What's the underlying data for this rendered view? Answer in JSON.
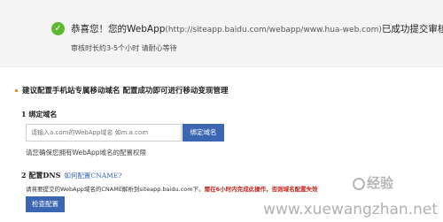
{
  "banner": {
    "check_icon": "check-circle-icon",
    "msg_prefix": "恭喜您！您的WebApp",
    "msg_url": "(http://siteapp.baidu.com/webapp/www.hua-web.com)",
    "msg_suffix": "已成功提交审核",
    "sub": "审核时长约3-5个小时  请耐心等待"
  },
  "section": {
    "heading": "建议配置手机站专属移动域名  配置成功即可进行移动变现管理"
  },
  "step1": {
    "title": "1  绑定域名",
    "input_placeholder": "请输入a.com的WebApp域名 如m.a.com",
    "bind_button": "绑定域名",
    "note": "请您确保您拥有WebApp域名的配置权限"
  },
  "step2": {
    "title": "2  配置DNS",
    "help_link": "如何配置CNAME?",
    "text_normal": "请将要提交的WebApp域名的CNAME解析到siteapp.baidu.com下。",
    "text_warn": "需在6小时内完成此操作，否则域名配置失效",
    "check_button": "检查配置"
  },
  "watermark": {
    "logo": "经验",
    "url": "www.xuewangzhan.net"
  }
}
